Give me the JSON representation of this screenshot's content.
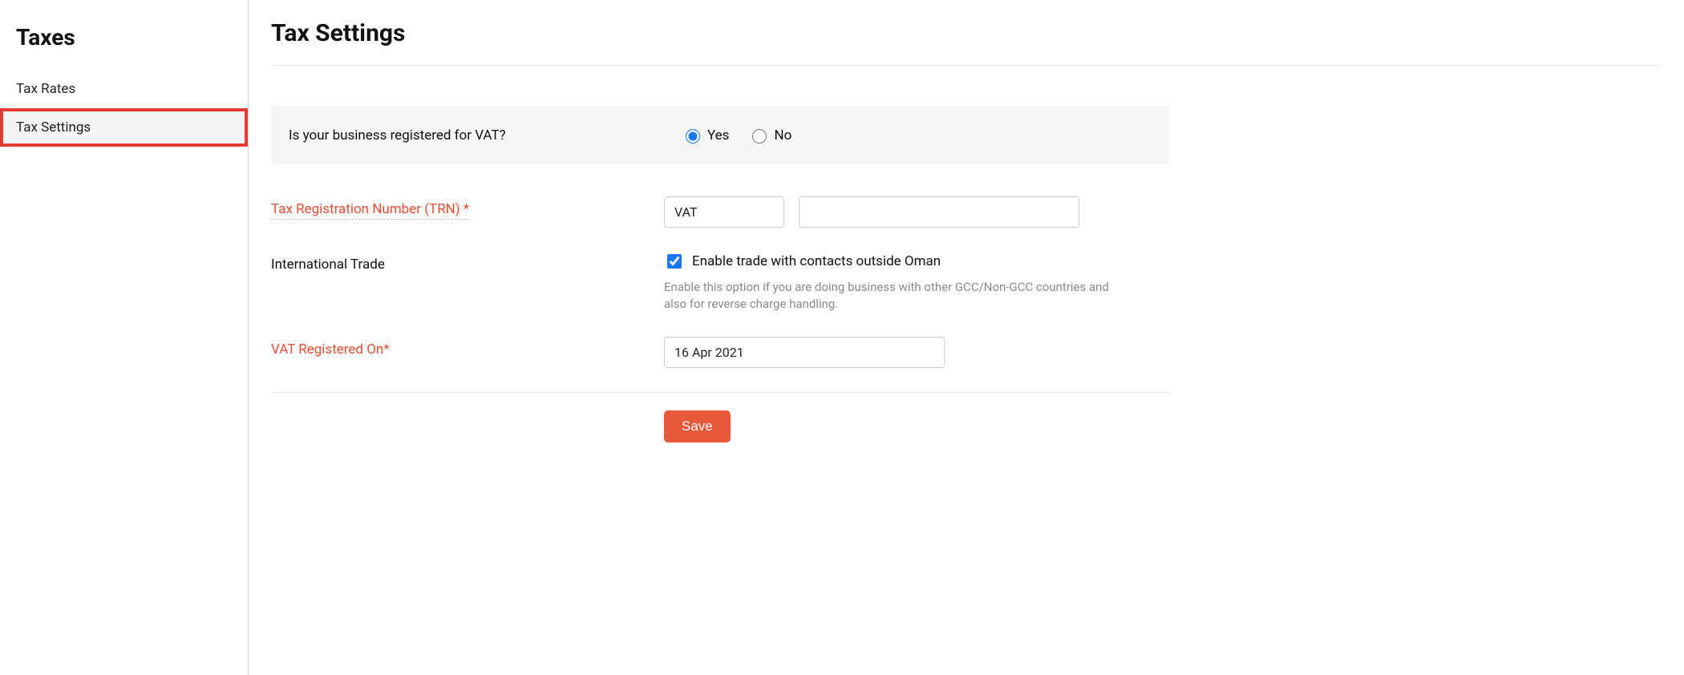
{
  "sidebar": {
    "title": "Taxes",
    "items": [
      {
        "label": "Tax Rates"
      },
      {
        "label": "Tax Settings"
      }
    ]
  },
  "page": {
    "title": "Tax Settings"
  },
  "vat_question": {
    "label": "Is your business registered for VAT?",
    "options": {
      "yes": "Yes",
      "no": "No"
    },
    "selected": "yes"
  },
  "trn": {
    "label": "Tax Registration Number (TRN) *",
    "prefix_value": "VAT",
    "number_value": ""
  },
  "intl": {
    "label": "International Trade",
    "checkbox_label": "Enable trade with contacts outside Oman",
    "checked": true,
    "help": "Enable this option if you are doing business with other GCC/Non-GCC countries and also for reverse charge handling."
  },
  "vat_date": {
    "label": "VAT Registered On*",
    "value": "16 Apr 2021"
  },
  "buttons": {
    "save": "Save"
  }
}
